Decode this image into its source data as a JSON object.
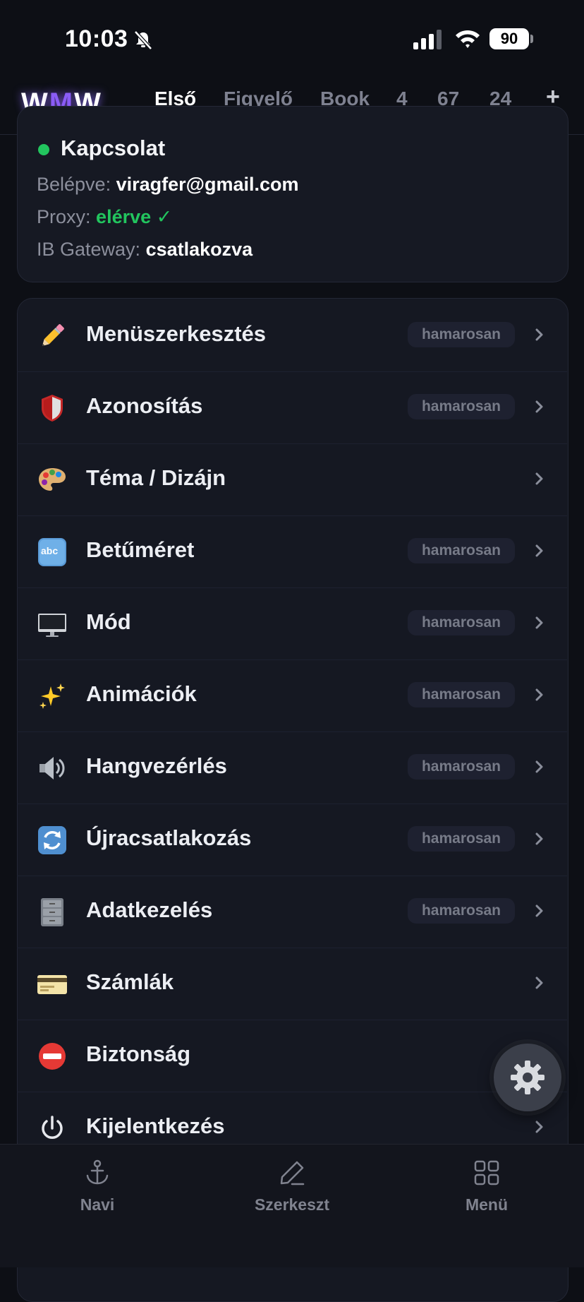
{
  "status_bar": {
    "time": "10:03",
    "battery": "90"
  },
  "header": {
    "logo": {
      "w1": "W",
      "m": "M",
      "w2": "W"
    },
    "tabs": [
      {
        "label": "Első",
        "active": true
      },
      {
        "label": "Figyelő"
      },
      {
        "label": "Book"
      },
      {
        "label": "4"
      },
      {
        "label": "67"
      },
      {
        "label": "24"
      }
    ],
    "add_label": "+"
  },
  "connection": {
    "title": "Kapcsolat",
    "login_label": "Belépve:",
    "login_value": "viragfer@gmail.com",
    "proxy_label": "Proxy:",
    "proxy_value": "elérve ✓",
    "gateway_label": "IB Gateway:",
    "gateway_value": "csatlakozva"
  },
  "settings": {
    "items": [
      {
        "icon": "pencil-icon",
        "label": "Menüszerkesztés",
        "badge": "hamarosan"
      },
      {
        "icon": "shield-icon",
        "label": "Azonosítás",
        "badge": "hamarosan"
      },
      {
        "icon": "palette-icon",
        "label": "Téma / Dizájn"
      },
      {
        "icon": "abc-icon",
        "label": "Betűméret",
        "badge": "hamarosan"
      },
      {
        "icon": "monitor-icon",
        "label": "Mód",
        "badge": "hamarosan"
      },
      {
        "icon": "sparkles-icon",
        "label": "Animációk",
        "badge": "hamarosan"
      },
      {
        "icon": "speaker-icon",
        "label": "Hangvezérlés",
        "badge": "hamarosan"
      },
      {
        "icon": "reconnect-icon",
        "label": "Újracsatlakozás",
        "badge": "hamarosan"
      },
      {
        "icon": "file-cabinet-icon",
        "label": "Adatkezelés",
        "badge": "hamarosan"
      },
      {
        "icon": "credit-card-icon",
        "label": "Számlák"
      },
      {
        "icon": "no-entry-icon",
        "label": "Biztonság"
      },
      {
        "icon": "power-icon",
        "label": "Kijelentkezés"
      }
    ]
  },
  "bottom_nav": [
    {
      "icon": "anchor-icon",
      "label": "Navi"
    },
    {
      "icon": "pen-icon",
      "label": "Szerkeszt"
    },
    {
      "icon": "grid-icon",
      "label": "Menü"
    }
  ],
  "colors": {
    "accent": "#8b5cf6",
    "success": "#22c55e",
    "background": "#0d0f15"
  }
}
